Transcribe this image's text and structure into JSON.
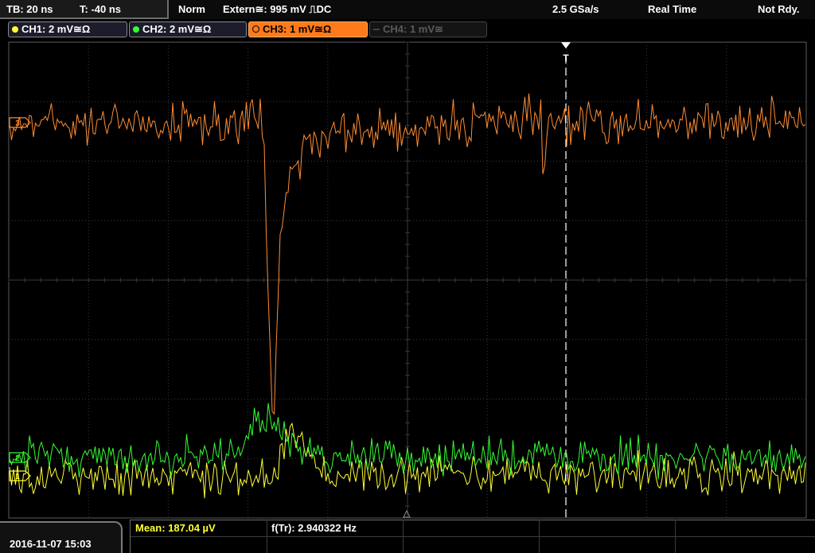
{
  "header": {
    "timebase": "TB: 20 ns",
    "trigger_offset": "T: -40 ns",
    "acq_mode": "Norm",
    "trigger_source": "Extern≅: 995 mV ⎍DC",
    "sample_rate": "2.5 GSa/s",
    "mode": "Real Time",
    "status": "Not Rdy."
  },
  "channels": [
    {
      "label": "CH1: 2 mV≅Ω",
      "color": "#ffff33",
      "state": "on"
    },
    {
      "label": "CH2: 2 mV≅Ω",
      "color": "#33ff33",
      "state": "on"
    },
    {
      "label": "CH3: 1 mV≅Ω",
      "color": "#ff8c33",
      "state": "selected"
    },
    {
      "label": "CH4: 1 mV≅",
      "color": "#5a5a5a",
      "state": "off"
    }
  ],
  "markers": {
    "trigger_marker": "T",
    "ch_markers": [
      "3",
      "2",
      "1"
    ]
  },
  "measurements": {
    "mean": "Mean: 187.04 µV",
    "freq": "f(Tr): 2.940322 Hz"
  },
  "datetime": "2016-11-07 15:03",
  "colors": {
    "ch1": "#ffff33",
    "ch2": "#33ff33",
    "ch3": "#ff8c33",
    "grid": "#3a3a3a",
    "trigger_line": "#ffffff"
  },
  "icons": [
    "circle-dot-icon",
    "trigger-arrow-icon",
    "channel-marker-icon"
  ]
}
